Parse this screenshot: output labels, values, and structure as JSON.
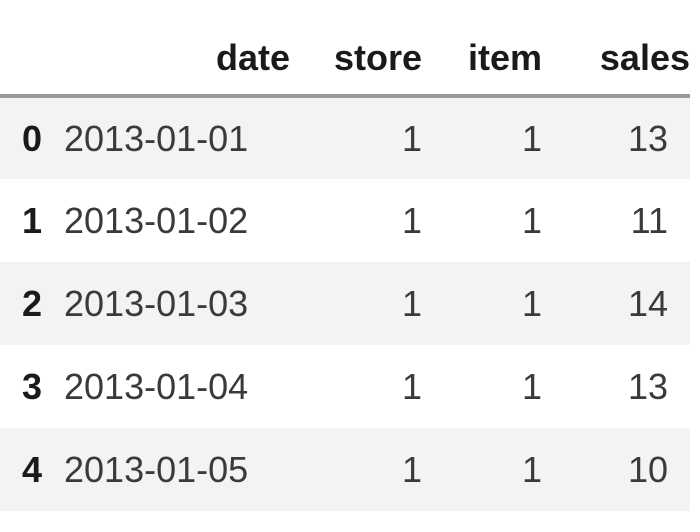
{
  "table": {
    "columns": [
      "date",
      "store",
      "item",
      "sales"
    ],
    "rows": [
      {
        "index": "0",
        "date": "2013-01-01",
        "store": "1",
        "item": "1",
        "sales": "13"
      },
      {
        "index": "1",
        "date": "2013-01-02",
        "store": "1",
        "item": "1",
        "sales": "11"
      },
      {
        "index": "2",
        "date": "2013-01-03",
        "store": "1",
        "item": "1",
        "sales": "14"
      },
      {
        "index": "3",
        "date": "2013-01-04",
        "store": "1",
        "item": "1",
        "sales": "13"
      },
      {
        "index": "4",
        "date": "2013-01-05",
        "store": "1",
        "item": "1",
        "sales": "10"
      }
    ]
  },
  "colors": {
    "header_rule": "#9a9a9a",
    "stripe": "#f3f3f3",
    "text": "#1a1a1a"
  }
}
